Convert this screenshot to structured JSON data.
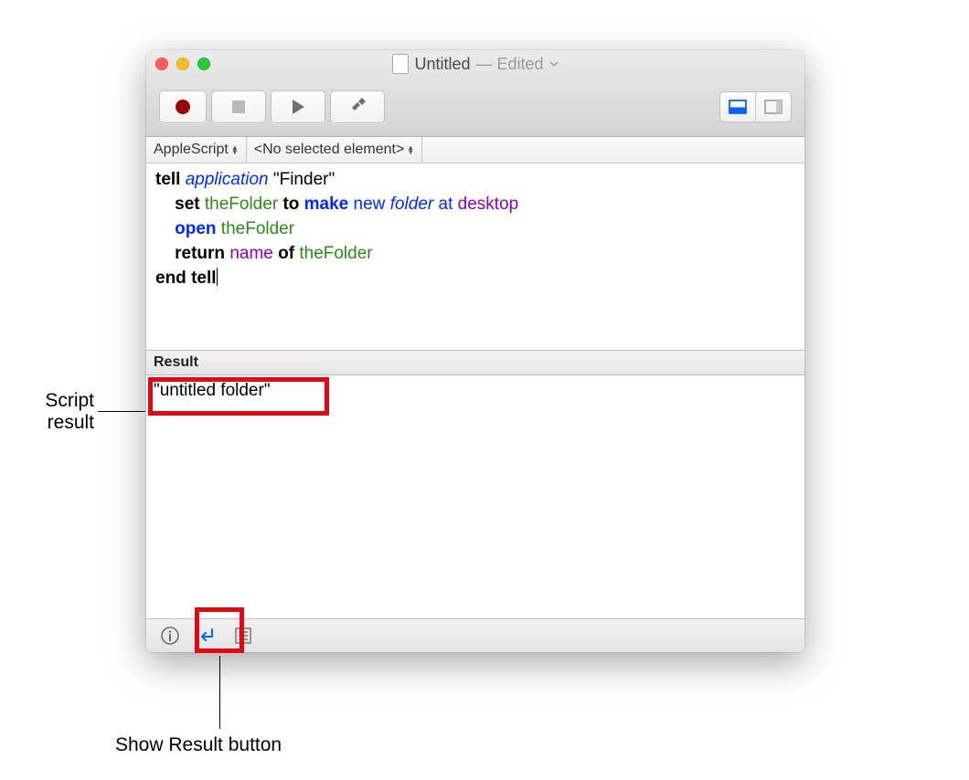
{
  "window": {
    "title": "Untitled",
    "status": "Edited"
  },
  "navbar": {
    "language": "AppleScript",
    "element": "<No selected element>"
  },
  "script": {
    "line1_tell": "tell",
    "line1_app": "application",
    "line1_target": "\"Finder\"",
    "line2_set": "set",
    "line2_var": "theFolder",
    "line2_to": "to",
    "line2_make": "make",
    "line2_new": "new",
    "line2_folder": "folder",
    "line2_at": "at",
    "line2_desktop": "desktop",
    "line3_open": "open",
    "line3_var": "theFolder",
    "line4_return": "return",
    "line4_name": "name",
    "line4_of": "of",
    "line4_var": "theFolder",
    "line5_end": "end",
    "line5_tell": "tell"
  },
  "result": {
    "header": "Result",
    "value": "\"untitled folder\""
  },
  "annotations": {
    "script_result": "Script result",
    "show_result_button": "Show Result button"
  }
}
